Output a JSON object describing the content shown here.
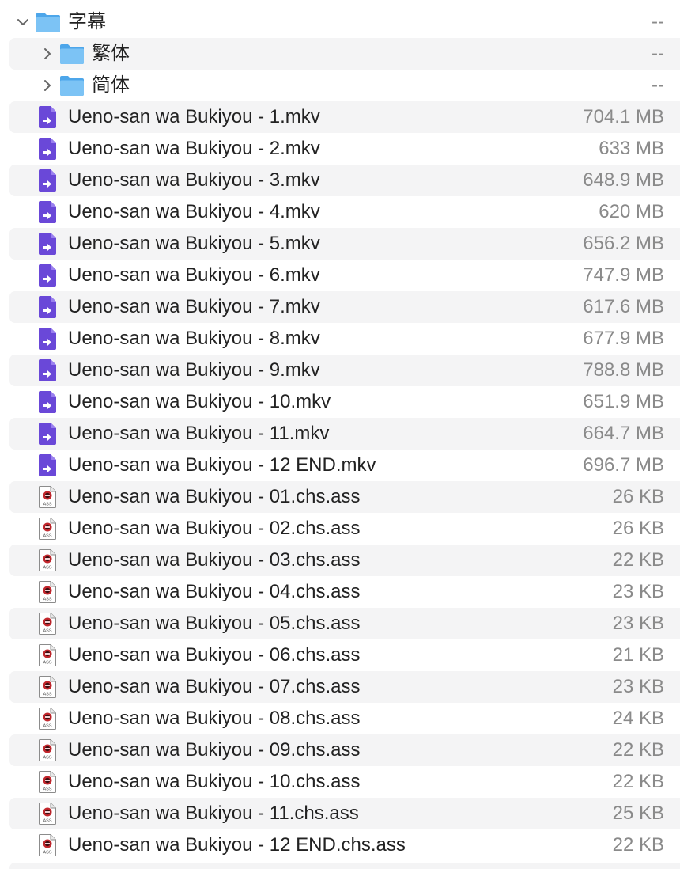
{
  "folder": {
    "name": "字幕",
    "size": "--",
    "expanded": true,
    "icon": "folder-icon",
    "subfolders": [
      {
        "name": "繁体",
        "size": "--",
        "icon": "folder-icon"
      },
      {
        "name": "简体",
        "size": "--",
        "icon": "folder-icon"
      }
    ]
  },
  "files": [
    {
      "name": "Ueno-san wa Bukiyou - 1.mkv",
      "size": "704.1 MB",
      "type": "video"
    },
    {
      "name": "Ueno-san wa Bukiyou - 2.mkv",
      "size": "633 MB",
      "type": "video"
    },
    {
      "name": "Ueno-san wa Bukiyou - 3.mkv",
      "size": "648.9 MB",
      "type": "video"
    },
    {
      "name": "Ueno-san wa Bukiyou - 4.mkv",
      "size": "620 MB",
      "type": "video"
    },
    {
      "name": "Ueno-san wa Bukiyou - 5.mkv",
      "size": "656.2 MB",
      "type": "video"
    },
    {
      "name": "Ueno-san wa Bukiyou - 6.mkv",
      "size": "747.9 MB",
      "type": "video"
    },
    {
      "name": "Ueno-san wa Bukiyou - 7.mkv",
      "size": "617.6 MB",
      "type": "video"
    },
    {
      "name": "Ueno-san wa Bukiyou - 8.mkv",
      "size": "677.9 MB",
      "type": "video"
    },
    {
      "name": "Ueno-san wa Bukiyou - 9.mkv",
      "size": "788.8 MB",
      "type": "video"
    },
    {
      "name": "Ueno-san wa Bukiyou - 10.mkv",
      "size": "651.9 MB",
      "type": "video"
    },
    {
      "name": "Ueno-san wa Bukiyou - 11.mkv",
      "size": "664.7 MB",
      "type": "video"
    },
    {
      "name": "Ueno-san wa Bukiyou - 12 END.mkv",
      "size": "696.7 MB",
      "type": "video"
    },
    {
      "name": "Ueno-san wa Bukiyou - 01.chs.ass",
      "size": "26 KB",
      "type": "subtitle"
    },
    {
      "name": "Ueno-san wa Bukiyou - 02.chs.ass",
      "size": "26 KB",
      "type": "subtitle"
    },
    {
      "name": "Ueno-san wa Bukiyou - 03.chs.ass",
      "size": "22 KB",
      "type": "subtitle"
    },
    {
      "name": "Ueno-san wa Bukiyou - 04.chs.ass",
      "size": "23 KB",
      "type": "subtitle"
    },
    {
      "name": "Ueno-san wa Bukiyou - 05.chs.ass",
      "size": "23 KB",
      "type": "subtitle"
    },
    {
      "name": "Ueno-san wa Bukiyou - 06.chs.ass",
      "size": "21 KB",
      "type": "subtitle"
    },
    {
      "name": "Ueno-san wa Bukiyou - 07.chs.ass",
      "size": "23 KB",
      "type": "subtitle"
    },
    {
      "name": "Ueno-san wa Bukiyou - 08.chs.ass",
      "size": "24 KB",
      "type": "subtitle"
    },
    {
      "name": "Ueno-san wa Bukiyou - 09.chs.ass",
      "size": "22 KB",
      "type": "subtitle"
    },
    {
      "name": "Ueno-san wa Bukiyou - 10.chs.ass",
      "size": "22 KB",
      "type": "subtitle"
    },
    {
      "name": "Ueno-san wa Bukiyou - 11.chs.ass",
      "size": "25 KB",
      "type": "subtitle"
    },
    {
      "name": "Ueno-san wa Bukiyou - 12 END.chs.ass",
      "size": "22 KB",
      "type": "subtitle"
    }
  ],
  "file_icons": {
    "video": "video-file-icon",
    "subtitle": "ass-subtitle-file-icon"
  },
  "subtitle_icon_label": "ASS",
  "colors": {
    "stripe": "#f4f4f5",
    "folder": "#5fb3f0",
    "video_icon": "#6a48d8",
    "subtitle_icon_badge": "#c2272d"
  }
}
